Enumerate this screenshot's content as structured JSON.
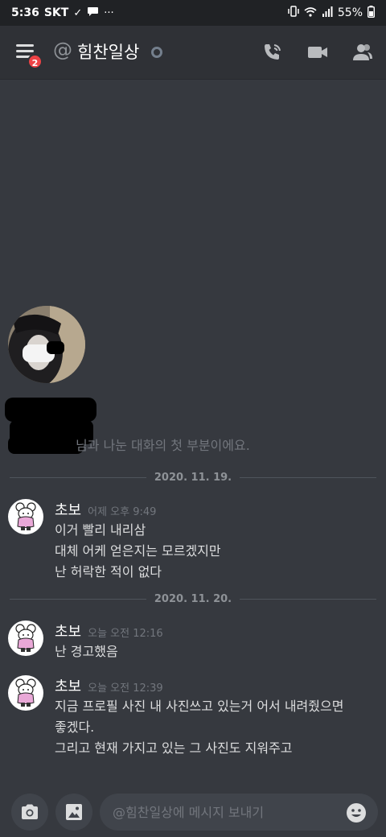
{
  "status_bar": {
    "time": "5:36",
    "carrier": "SKT",
    "dots": "···",
    "battery": "55%"
  },
  "header": {
    "notification_count": "2",
    "at_symbol": "@",
    "title": "힘찬일상"
  },
  "intro": {
    "text": "님과 나눈 대화의 첫 부분이에요."
  },
  "dividers": [
    "2020. 11. 19.",
    "2020. 11. 20."
  ],
  "messages": [
    {
      "username": "초보",
      "timestamp": "어제 오후 9:49",
      "lines": [
        "이거 빨리 내리삼",
        "대체 어케 얻은지는 모르겠지만",
        "난 허락한 적이 없다"
      ]
    },
    {
      "username": "초보",
      "timestamp": "오늘 오전 12:16",
      "lines": [
        "난 경고했음"
      ]
    },
    {
      "username": "초보",
      "timestamp": "오늘 오전 12:39",
      "lines": [
        "지금 프로필 사진 내 사진쓰고 있는거 어서 내려줬으면",
        "좋겠다.",
        "그리고 현재 가지고 있는 그 사진도 지워주고"
      ]
    }
  ],
  "composer": {
    "placeholder": "@힘찬일상에 메시지 보내기"
  },
  "colors": {
    "background": "#36393f",
    "header": "#2f3136",
    "badge": "#ed4245",
    "muted_text": "#72767d"
  }
}
